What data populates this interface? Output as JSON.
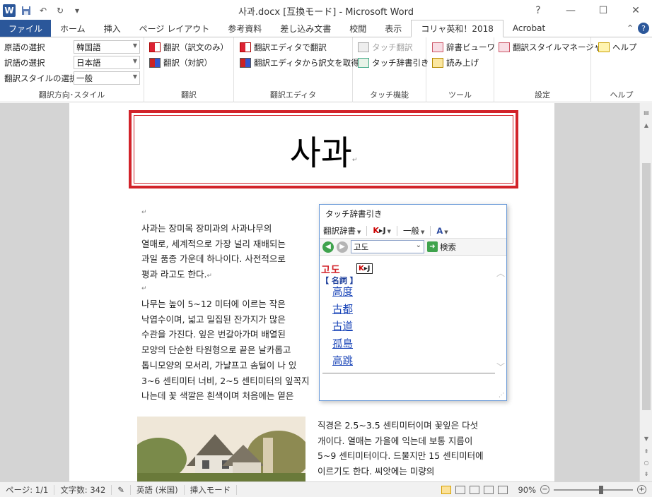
{
  "app": {
    "title": "사과.docx [互換モード] - Microsoft Word",
    "logo": "W"
  },
  "tabs": [
    {
      "label": "ファイル"
    },
    {
      "label": "ホーム"
    },
    {
      "label": "挿入"
    },
    {
      "label": "ページ レイアウト"
    },
    {
      "label": "参考資料"
    },
    {
      "label": "差し込み文書"
    },
    {
      "label": "校閲"
    },
    {
      "label": "表示"
    },
    {
      "label": "コリャ英和！2018"
    },
    {
      "label": "Acrobat"
    }
  ],
  "ribbon": {
    "direction": {
      "source_label": "原語の選択",
      "source_value": "韓国語",
      "target_label": "訳語の選択",
      "target_value": "日本語",
      "style_label": "翻訳スタイルの選択",
      "style_value": "一般",
      "group": "翻訳方向･スタイル"
    },
    "translate": {
      "item1": "翻訳（訳文のみ）",
      "item2": "翻訳（対訳）",
      "group": "翻訳"
    },
    "editor": {
      "item1": "翻訳エディタで翻訳",
      "item2": "翻訳エディタから訳文を取得",
      "group": "翻訳エディタ"
    },
    "touch": {
      "item1": "タッチ翻訳",
      "item2": "タッチ辞書引き",
      "group": "タッチ機能"
    },
    "tools": {
      "item1": "辞書ビューワ",
      "item2": "読み上げ",
      "group": "ツール"
    },
    "settings": {
      "item1": "翻訳スタイルマネージャ",
      "group": "設定"
    },
    "help": {
      "item1": "ヘルプ",
      "group": "ヘルプ"
    }
  },
  "document": {
    "title": "사과",
    "para_mark": "↵",
    "para1": [
      "사과는 장미목 장미과의 사과나무의",
      "열매로, 세계적으로 가장 널리 재배되는",
      "과일 품종 가운데 하나이다. 사전적으로",
      "평과 라고도 한다."
    ],
    "para2": [
      "나무는 높이 5~12 미터에 이르는 작은",
      "낙엽수이며, 넓고 밀집된 잔가지가 많은",
      "수관을 가진다. 잎은 번갈아가며 배열된",
      "모양의 단순한 타원형으로 끝은 날카롭고",
      "톱니모양의 모서리, 가냘프고 솜털이 나 있",
      "3~6 센티미터 너비, 2~5 센티미터의 잎꼭지",
      "나는데 꽃 색깔은 흰색이며 처음에는 옅은"
    ],
    "para3": [
      "직경은 2.5~3.5 센티미터이며 꽃잎은 다섯",
      "개이다. 열매는 가을에 익는데 보통 지름이",
      "5~9 센티미터이다. 드물지만 15 센티미터에",
      "이르기도 한다. 씨앗에는 미량의"
    ]
  },
  "popup": {
    "title": "タッチ辞書引き",
    "dict_label": "翻訳辞書",
    "kj_label_k": "K",
    "kj_label_j": "J",
    "style_label": "一般",
    "search_value": "고도",
    "search_button": "検索",
    "headword": "고도",
    "badge_k": "K",
    "badge_j": "J",
    "pos": "【 名詞 】",
    "senses": [
      "高度",
      "古都",
      "古道",
      "孤島",
      "高跳"
    ]
  },
  "status": {
    "page": "ページ: 1/1",
    "words": "文字数: 342",
    "language": "英語 (米国)",
    "mode": "挿入モード",
    "zoom": "90%",
    "zoom_fraction": 0.6
  }
}
